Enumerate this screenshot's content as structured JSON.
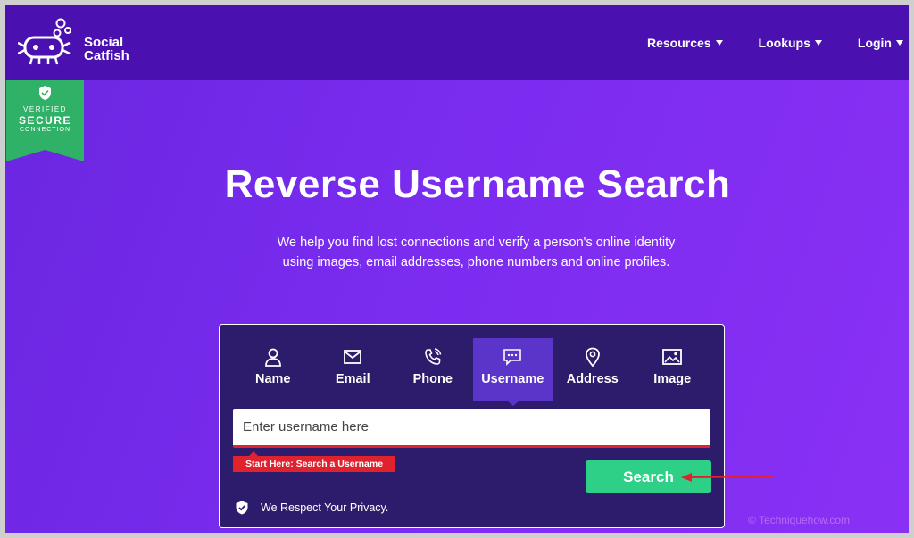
{
  "header": {
    "logo_line1": "Social",
    "logo_line2": "Catfish",
    "nav": [
      {
        "label": "Resources"
      },
      {
        "label": "Lookups"
      },
      {
        "label": "Login"
      }
    ]
  },
  "badge": {
    "line1": "VERIFIED",
    "line2": "SECURE",
    "line3": "CONNECTION"
  },
  "hero": {
    "title": "Reverse Username Search",
    "subtitle": "We help you find lost connections and verify a person's online identity using images, email addresses, phone numbers and online profiles."
  },
  "search": {
    "tabs": [
      {
        "label": "Name",
        "icon": "person-icon"
      },
      {
        "label": "Email",
        "icon": "envelope-icon"
      },
      {
        "label": "Phone",
        "icon": "phone-icon"
      },
      {
        "label": "Username",
        "icon": "chat-bubble-icon",
        "active": true
      },
      {
        "label": "Address",
        "icon": "map-pin-icon"
      },
      {
        "label": "Image",
        "icon": "image-icon"
      }
    ],
    "placeholder": "Enter username here",
    "hint": "Start Here: Search a Username",
    "button_label": "Search",
    "privacy_text": "We Respect Your Privacy."
  },
  "watermark": "© Techniquehow.com",
  "colors": {
    "header_bg": "#4a11b0",
    "hero_bg": "#7a2cef",
    "panel_bg": "#2d1b6b",
    "active_tab": "#5b34c9",
    "accent_red": "#e0222e",
    "search_green": "#2ecf86",
    "badge_green": "#2fb167"
  }
}
